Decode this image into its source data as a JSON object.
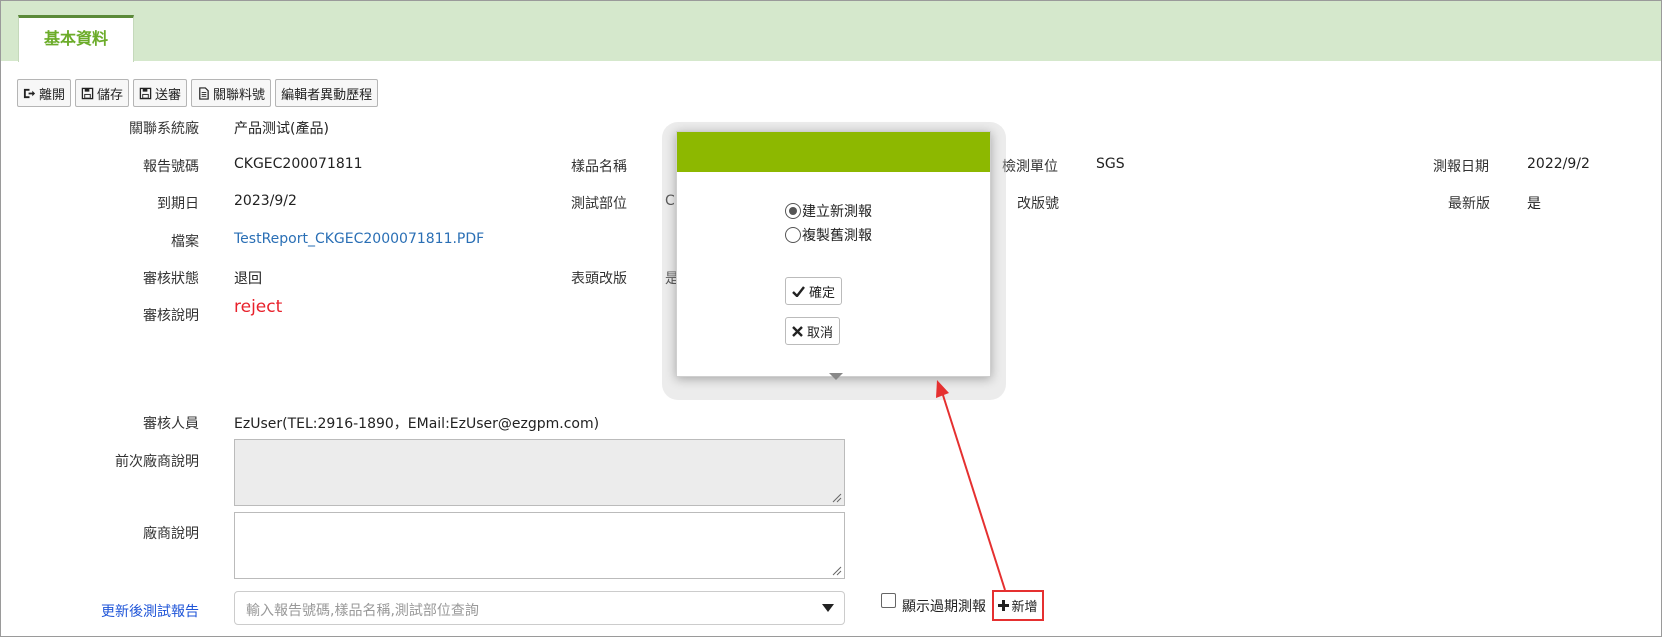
{
  "tabs": [
    {
      "label": "基本資料",
      "active": true
    }
  ],
  "toolbar": {
    "leave": "離開",
    "save": "儲存",
    "submit": "送審",
    "related_part": "關聯料號",
    "edit_history": "編輯者異動歷程"
  },
  "fields": {
    "related_vendor": {
      "label": "關聯系統廠",
      "value": "产品测试(產品)"
    },
    "report_no": {
      "label": "報告號碼",
      "value": "CKGEC200071811"
    },
    "sample_name": {
      "label": "樣品名稱",
      "value": ""
    },
    "test_unit": {
      "label": "檢測單位",
      "value": "SGS"
    },
    "report_date": {
      "label": "測報日期",
      "value": "2022/9/2"
    },
    "expiry_date": {
      "label": "到期日",
      "value": "2023/9/2"
    },
    "test_part": {
      "label": "測試部位",
      "value": "C"
    },
    "revision_no": {
      "label": "改版號",
      "value": ""
    },
    "latest": {
      "label": "最新版",
      "value": "是"
    },
    "file": {
      "label": "檔案",
      "value": "TestReport_CKGEC2000071811.PDF"
    },
    "review_status": {
      "label": "審核狀態",
      "value": "退回"
    },
    "header_revision": {
      "label": "表頭改版",
      "value": "是"
    },
    "review_note": {
      "label": "審核說明",
      "value": "reject"
    },
    "reviewer": {
      "label": "審核人員",
      "value": "EzUser(TEL:2916-1890，EMail:EzUser@ezgpm.com)"
    },
    "prev_vendor_note": {
      "label": "前次廠商說明"
    },
    "vendor_note": {
      "label": "廠商說明"
    },
    "updated_report": {
      "label": "更新後測試報告",
      "placeholder": "輸入報告號碼,樣品名稱,測試部位查詢"
    }
  },
  "show_expired": {
    "label": "顯示過期測報",
    "checked": false
  },
  "add_button": "新增",
  "popup": {
    "options": [
      {
        "label": "建立新測報",
        "selected": true
      },
      {
        "label": "複製舊測報",
        "selected": false
      }
    ],
    "confirm": "確定",
    "cancel": "取消"
  },
  "colors": {
    "tabbar_bg": "#d5e8cc",
    "tab_text": "#6cac2a",
    "popup_header": "#8db800",
    "reject_text": "#e8212b",
    "link": "#2a6fb5",
    "highlight": "#e53030"
  }
}
